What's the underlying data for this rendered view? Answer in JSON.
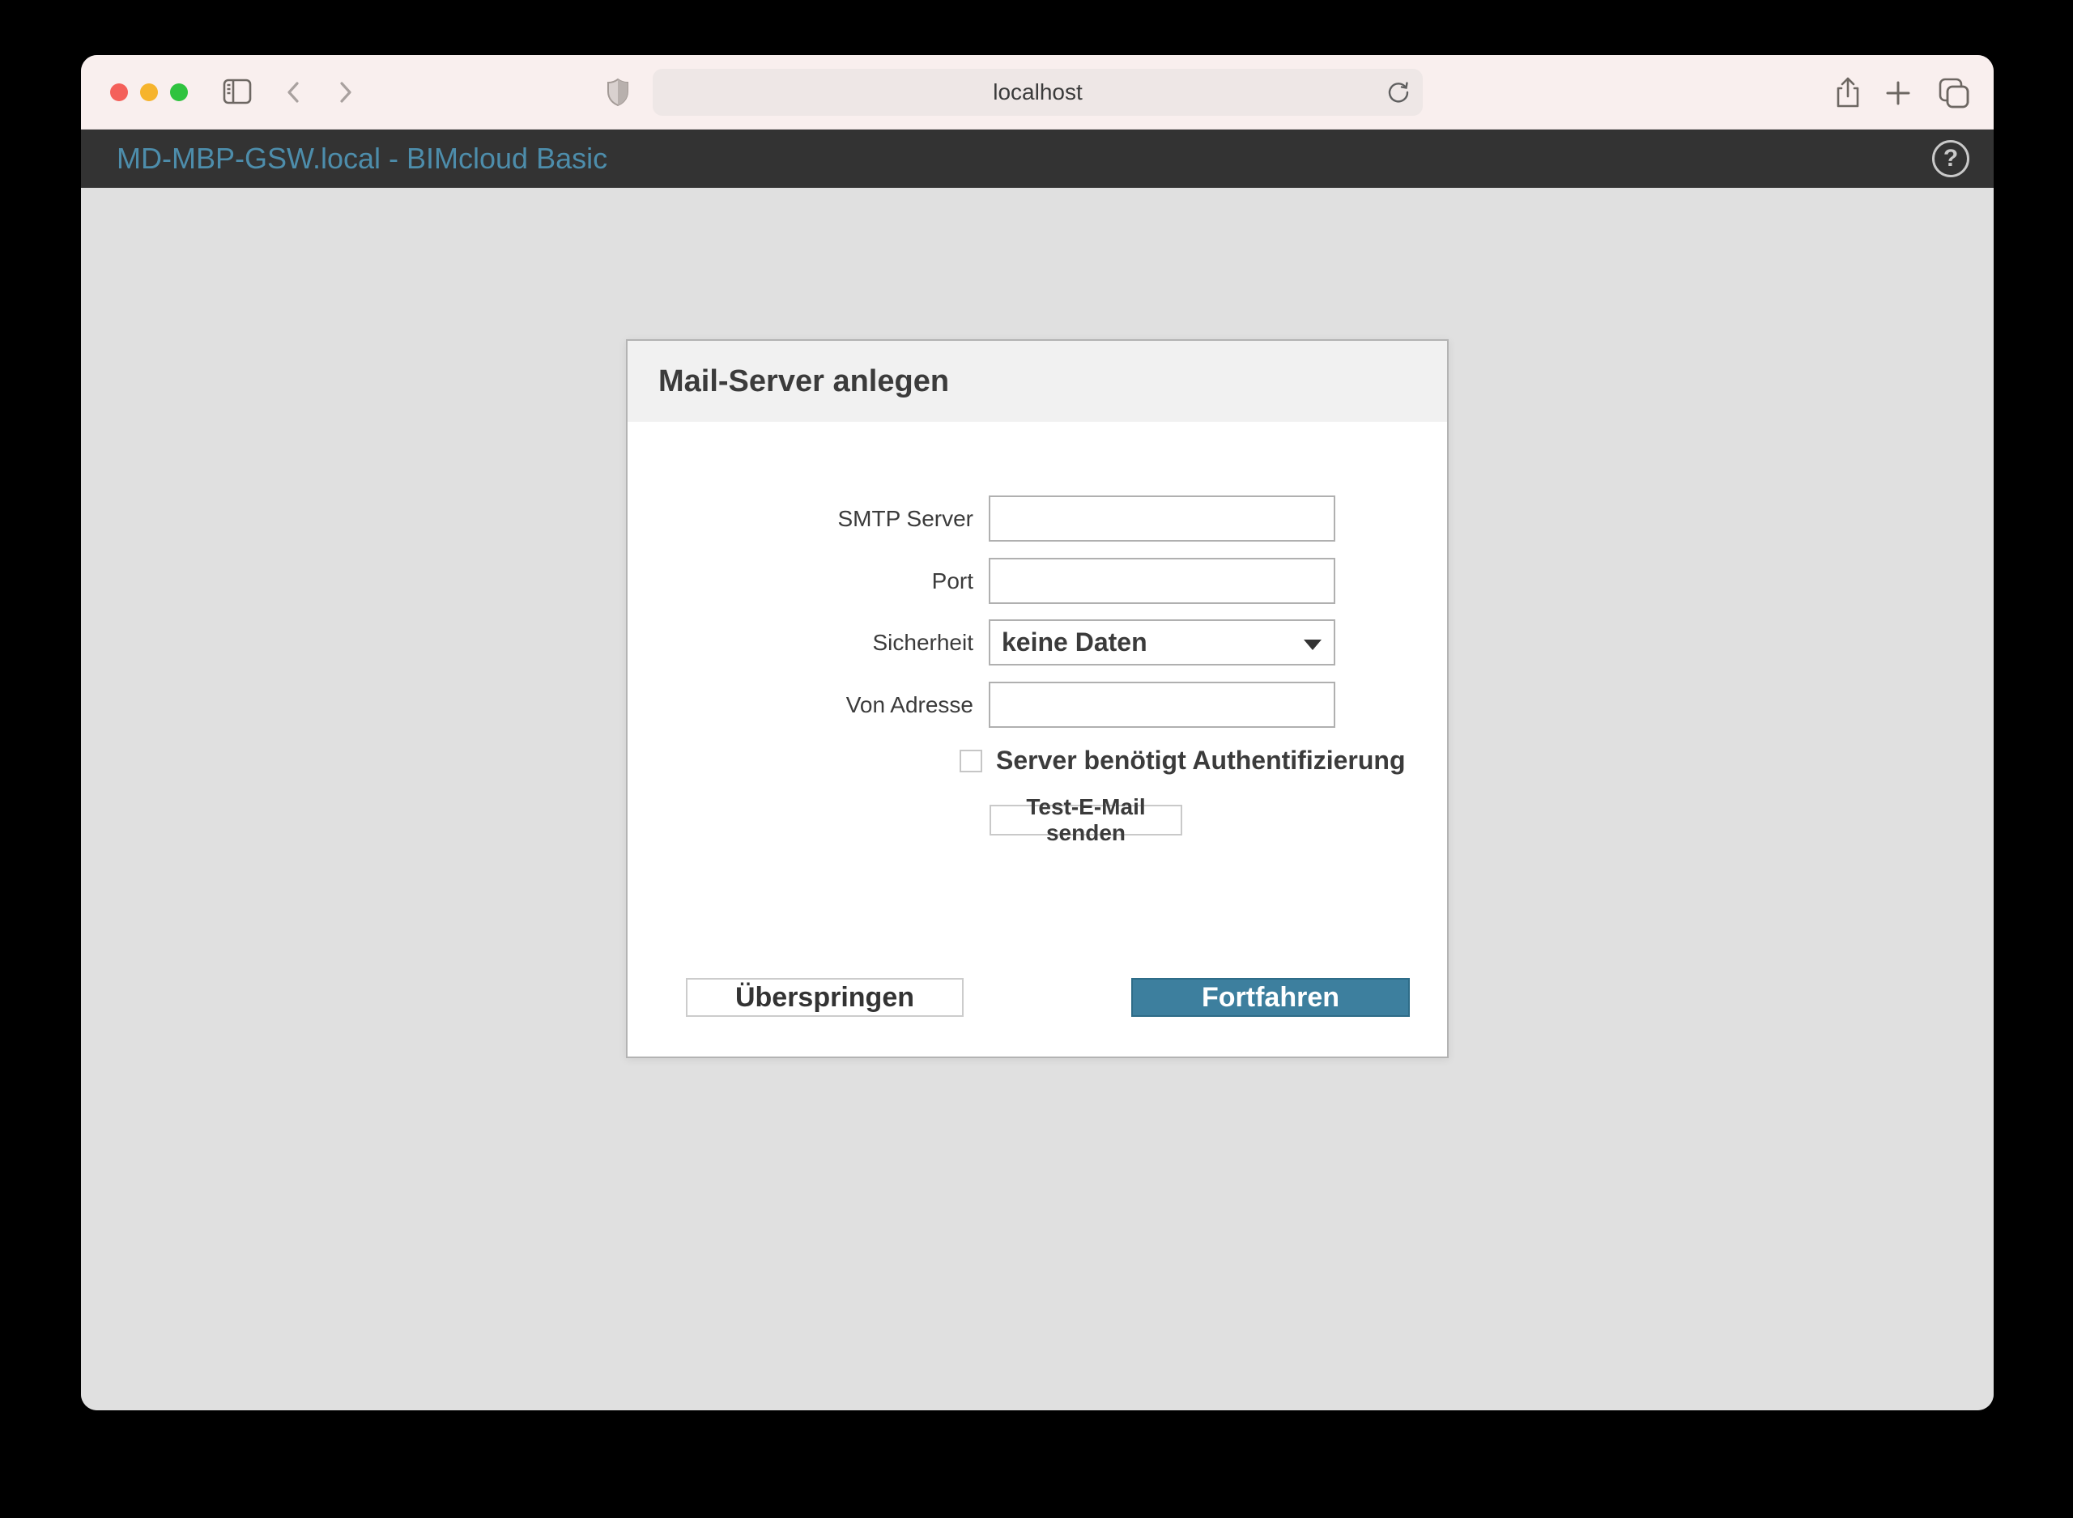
{
  "browser": {
    "url": "localhost",
    "traffic_lights": {
      "close": "red",
      "minimize": "yellow",
      "zoom": "green"
    },
    "icons": [
      "sidebar-toggle",
      "back-chevron",
      "forward-chevron",
      "privacy-shield",
      "refresh",
      "share",
      "new-tab",
      "tab-overview"
    ]
  },
  "header": {
    "title": "MD-MBP-GSW.local - BIMcloud Basic",
    "help_icon": "?"
  },
  "dialog": {
    "title": "Mail-Server anlegen",
    "fields": [
      {
        "label": "SMTP Server",
        "value": "",
        "type": "text"
      },
      {
        "label": "Port",
        "value": "",
        "type": "text"
      },
      {
        "label": "Sicherheit",
        "value": "keine Daten",
        "type": "select"
      },
      {
        "label": "Von Adresse",
        "value": "",
        "type": "text"
      }
    ],
    "checkbox": {
      "label": "Server benötigt Authentifizierung",
      "checked": false
    },
    "buttons": {
      "test": "Test-E-Mail senden",
      "skip": "Überspringen",
      "continue": "Fortfahren"
    }
  },
  "colors": {
    "toolbar_bg": "#f9efee",
    "site_header_bg": "#333333",
    "site_title": "#4d8dab",
    "page_bg": "#e0e0e0",
    "dialog_header_bg": "#f1f1f1",
    "accent_button": "#3d7f9e",
    "text": "#3b3b3b"
  }
}
